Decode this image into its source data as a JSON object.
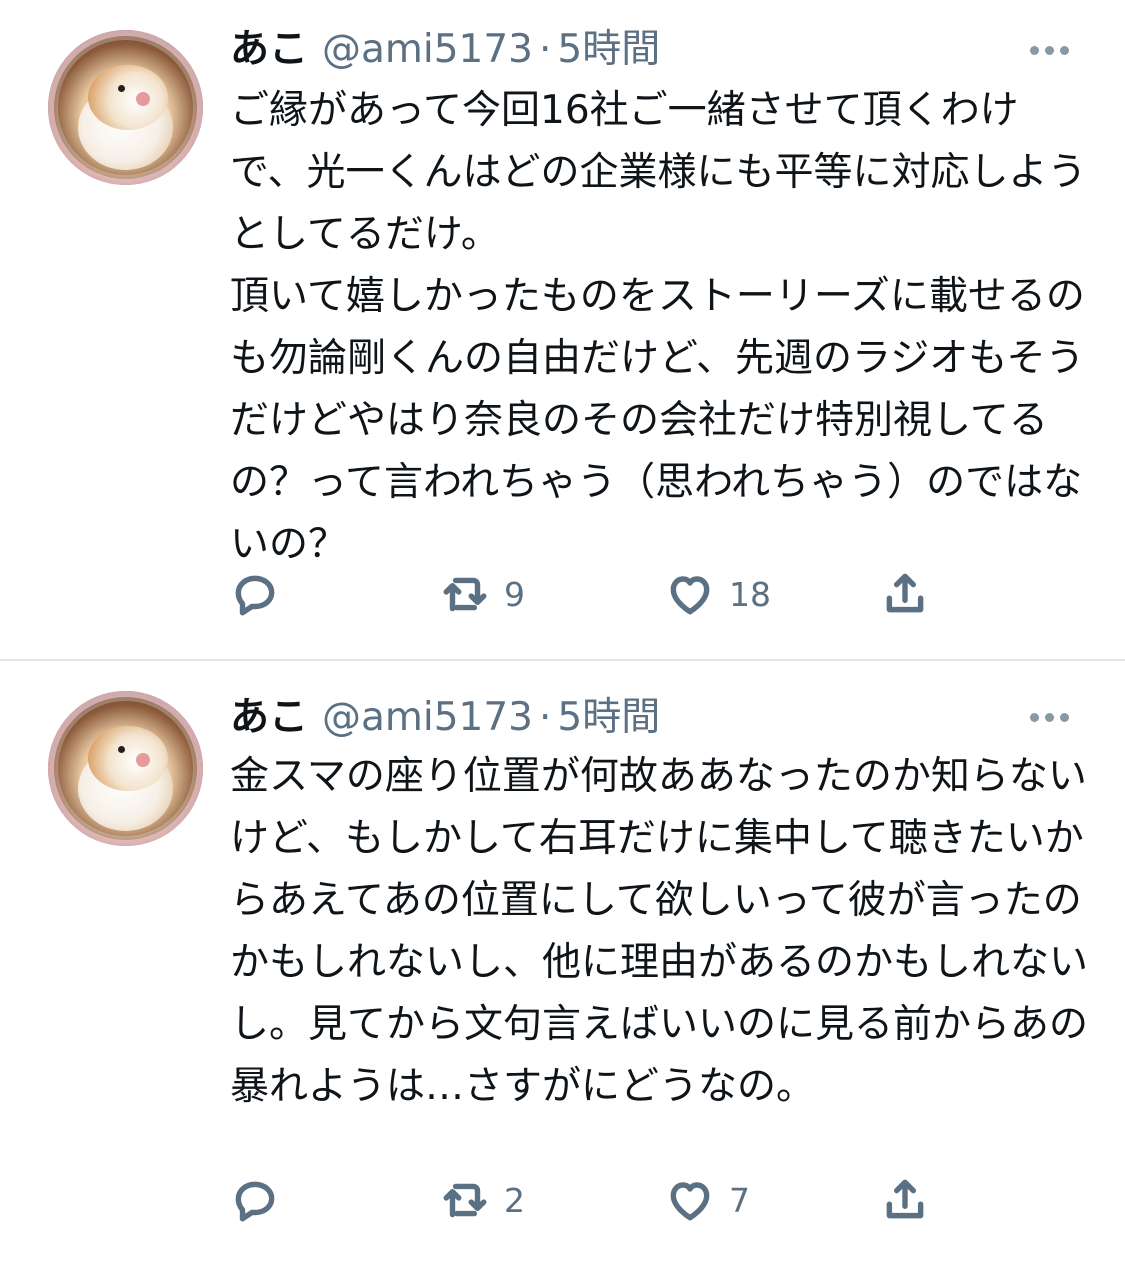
{
  "tweets": [
    {
      "name": "あこ",
      "handle": "@ami5173",
      "separator": "·",
      "time": "5時間",
      "text": "ご縁があって今回16社ご一緒させて頂くわけで、光一くんはどの企業様にも平等に対応しようとしてるだけ。\n頂いて嬉しかったものをストーリーズに載せるのも勿論剛くんの自由だけど、先週のラジオもそうだけどやはり奈良のその会社だけ特別視してるの？って言われちゃう（思われちゃう）のではないの？",
      "retweets": "9",
      "likes": "18"
    },
    {
      "name": "あこ",
      "handle": "@ami5173",
      "separator": "·",
      "time": "5時間",
      "text": "金スマの座り位置が何故ああなったのか知らないけど、もしかして右耳だけに集中して聴きたいからあえてあの位置にして欲しいって彼が言ったのかもしれないし、他に理由があるのかもしれないし。見てから文句言えばいいのに見る前からあの暴れようは…さすがにどうなの。",
      "retweets": "2",
      "likes": "7"
    }
  ],
  "icons": {
    "reply": "reply-icon",
    "retweet": "retweet-icon",
    "like": "heart-icon",
    "share": "share-icon",
    "more": "more-icon"
  },
  "colors": {
    "text": "#0f1419",
    "secondary": "#5b7083",
    "divider": "#e1e5e8"
  }
}
